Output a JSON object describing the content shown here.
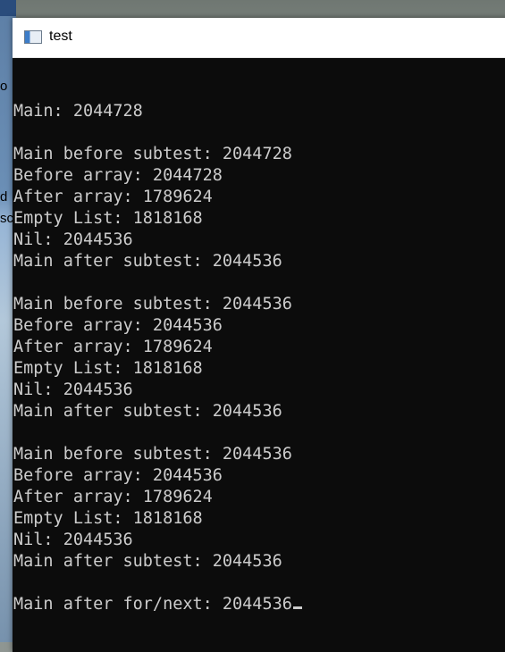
{
  "window": {
    "title": "test"
  },
  "desktop": {
    "fragments": [
      "o",
      "d",
      "sc"
    ]
  },
  "console": {
    "lines": [
      "",
      "Main: 2044728",
      "",
      "Main before subtest: 2044728",
      "Before array: 2044728",
      "After array: 1789624",
      "Empty List: 1818168",
      "Nil: 2044536",
      "Main after subtest: 2044536",
      "",
      "Main before subtest: 2044536",
      "Before array: 2044536",
      "After array: 1789624",
      "Empty List: 1818168",
      "Nil: 2044536",
      "Main after subtest: 2044536",
      "",
      "Main before subtest: 2044536",
      "Before array: 2044536",
      "After array: 1789624",
      "Empty List: 1818168",
      "Nil: 2044536",
      "Main after subtest: 2044536",
      "",
      "Main after for/next: 2044536"
    ]
  }
}
